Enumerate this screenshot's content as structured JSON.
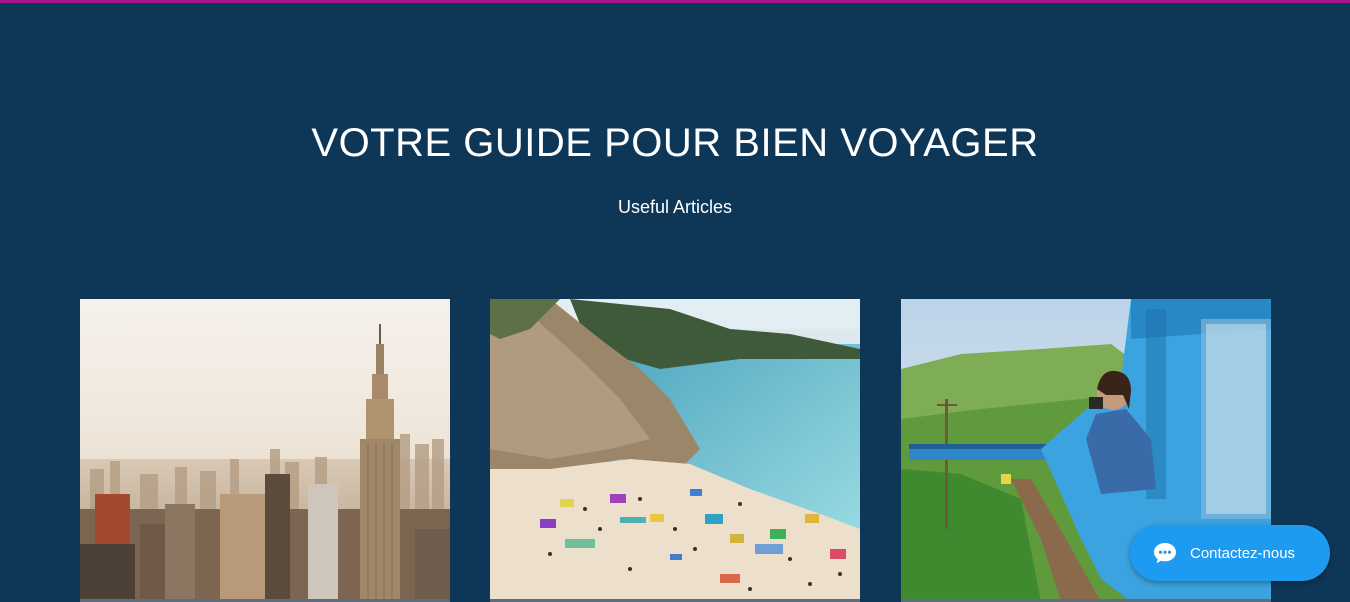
{
  "hero": {
    "title": "VOTRE GUIDE POUR BIEN VOYAGER",
    "subtitle": "Useful Articles"
  },
  "articles": [
    {
      "image": "city-skyline-photo"
    },
    {
      "image": "beach-cove-photo"
    },
    {
      "image": "train-traveler-photo"
    }
  ],
  "chat": {
    "label": "Contactez-nous",
    "icon": "chat-bubble-icon"
  },
  "colors": {
    "background": "#0e3757",
    "top_bar": "#a5158a",
    "chat_button": "#1d9bf0"
  }
}
